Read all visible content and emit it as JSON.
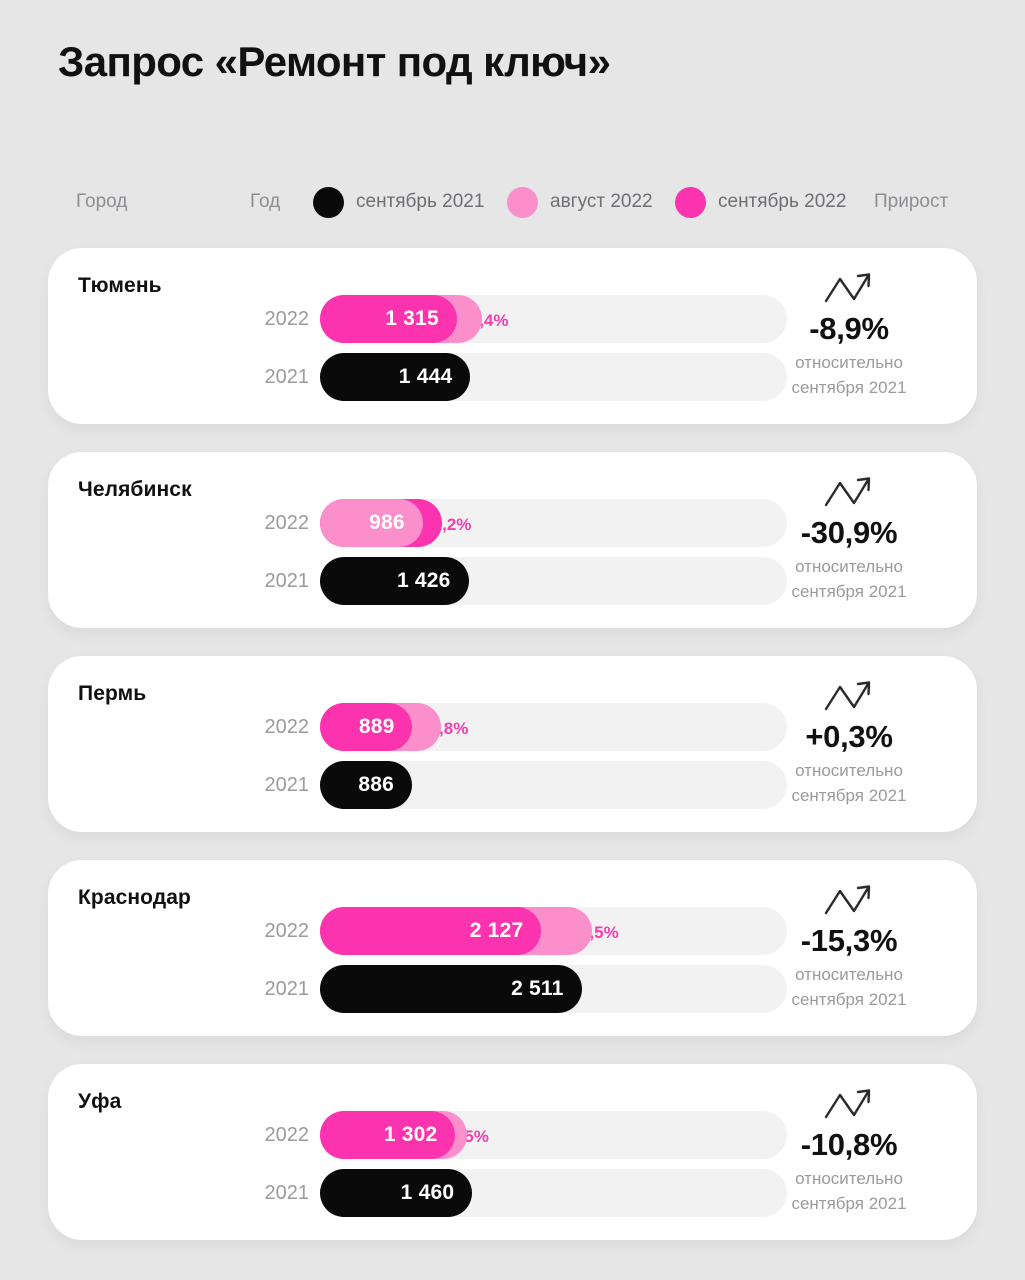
{
  "title": "Запрос «Ремонт под ключ»",
  "colors": {
    "background": "#e6e6e6",
    "card": "#ffffff",
    "track": "#f2f2f2",
    "sept_2021": "#0a0a0a",
    "aug_2022": "#fb8fcb",
    "sept_2022": "#fb33ae",
    "delta_text": "#f93bb0",
    "muted_text": "#9a9a9f"
  },
  "legend": {
    "city_label": "Город",
    "year_label": "Год",
    "growth_label": "Прирост",
    "items": [
      {
        "label": "сентябрь 2021",
        "color": "#0a0a0a",
        "icon": "legend-dot"
      },
      {
        "label": "август 2022",
        "color": "#fb8fcb",
        "icon": "legend-dot"
      },
      {
        "label": "сентябрь 2022",
        "color": "#fb33ae",
        "icon": "legend-dot"
      }
    ]
  },
  "growth_note_line1": "относительно",
  "growth_note_line2": "сентября 2021",
  "chart_data": {
    "type": "bar",
    "title": "Запрос «Ремонт под ключ»",
    "xlabel": "",
    "ylabel": "",
    "orientation": "horizontal",
    "axis_max": 4480,
    "legend_position": "top",
    "grid": false,
    "categories": [
      "Тюмень",
      "Челябинск",
      "Пермь",
      "Краснодар",
      "Уфа"
    ],
    "series": [
      {
        "name": "сентябрь 2021",
        "color": "#0a0a0a",
        "values": [
          1444,
          1426,
          886,
          2511,
          1460
        ]
      },
      {
        "name": "август 2022",
        "color": "#fb8fcb",
        "values": [
          1554,
          986,
          1167,
          2610,
          1408
        ]
      },
      {
        "name": "сентябрь 2022",
        "color": "#fb33ae",
        "values": [
          1315,
          1175,
          889,
          2127,
          1302
        ]
      }
    ],
    "month_over_month_labels": [
      "-15,4%",
      "+19,2%",
      "-23,8%",
      "-18,5%",
      "-7,5%"
    ],
    "year_over_year_labels": [
      "-8,9%",
      "-30,9%",
      "+0,3%",
      "-15,3%",
      "-10,8%"
    ]
  },
  "cards": [
    {
      "city": "Тюмень",
      "row_2022": {
        "year": "2022",
        "value_label": "1 315",
        "value_pct": 29.3,
        "secondary_pct": 34.6,
        "primary_color": "#fb33ae",
        "secondary_color": "#fb8fcb",
        "primary_on_top": true
      },
      "row_2021": {
        "year": "2021",
        "value_label": "1 444",
        "value_pct": 32.2,
        "color": "#0a0a0a"
      },
      "delta": "-15,4%",
      "delta_pos_pct": 34.6,
      "growth": "-8,9%"
    },
    {
      "city": "Челябинск",
      "row_2022": {
        "year": "2022",
        "value_label": "986",
        "value_pct": 22.0,
        "secondary_pct": 26.2,
        "primary_color": "#fb8fcb",
        "secondary_color": "#fb33ae",
        "primary_on_top": true
      },
      "row_2021": {
        "year": "2021",
        "value_label": "1 426",
        "value_pct": 31.8,
        "color": "#0a0a0a"
      },
      "delta": "+19,2%",
      "delta_pos_pct": 26.2,
      "growth": "-30,9%"
    },
    {
      "city": "Пермь",
      "row_2022": {
        "year": "2022",
        "value_label": "889",
        "value_pct": 19.8,
        "secondary_pct": 26.0,
        "primary_color": "#fb33ae",
        "secondary_color": "#fb8fcb",
        "primary_on_top": true
      },
      "row_2021": {
        "year": "2021",
        "value_label": "886",
        "value_pct": 19.7,
        "color": "#0a0a0a"
      },
      "delta": "-23,8%",
      "delta_pos_pct": 26.0,
      "growth": "+0,3%"
    },
    {
      "city": "Краснодар",
      "row_2022": {
        "year": "2022",
        "value_label": "2 127",
        "value_pct": 47.4,
        "secondary_pct": 58.2,
        "primary_color": "#fb33ae",
        "secondary_color": "#fb8fcb",
        "primary_on_top": true
      },
      "row_2021": {
        "year": "2021",
        "value_label": "2 511",
        "value_pct": 56.0,
        "color": "#0a0a0a"
      },
      "delta": "-18,5%",
      "delta_pos_pct": 58.2,
      "growth": "-15,3%"
    },
    {
      "city": "Уфа",
      "row_2022": {
        "year": "2022",
        "value_label": "1 302",
        "value_pct": 29.0,
        "secondary_pct": 31.4,
        "primary_color": "#fb33ae",
        "secondary_color": "#fb8fcb",
        "primary_on_top": true
      },
      "row_2021": {
        "year": "2021",
        "value_label": "1 460",
        "value_pct": 32.6,
        "color": "#0a0a0a"
      },
      "delta": "-7,5%",
      "delta_pos_pct": 31.4,
      "growth": "-10,8%"
    }
  ]
}
